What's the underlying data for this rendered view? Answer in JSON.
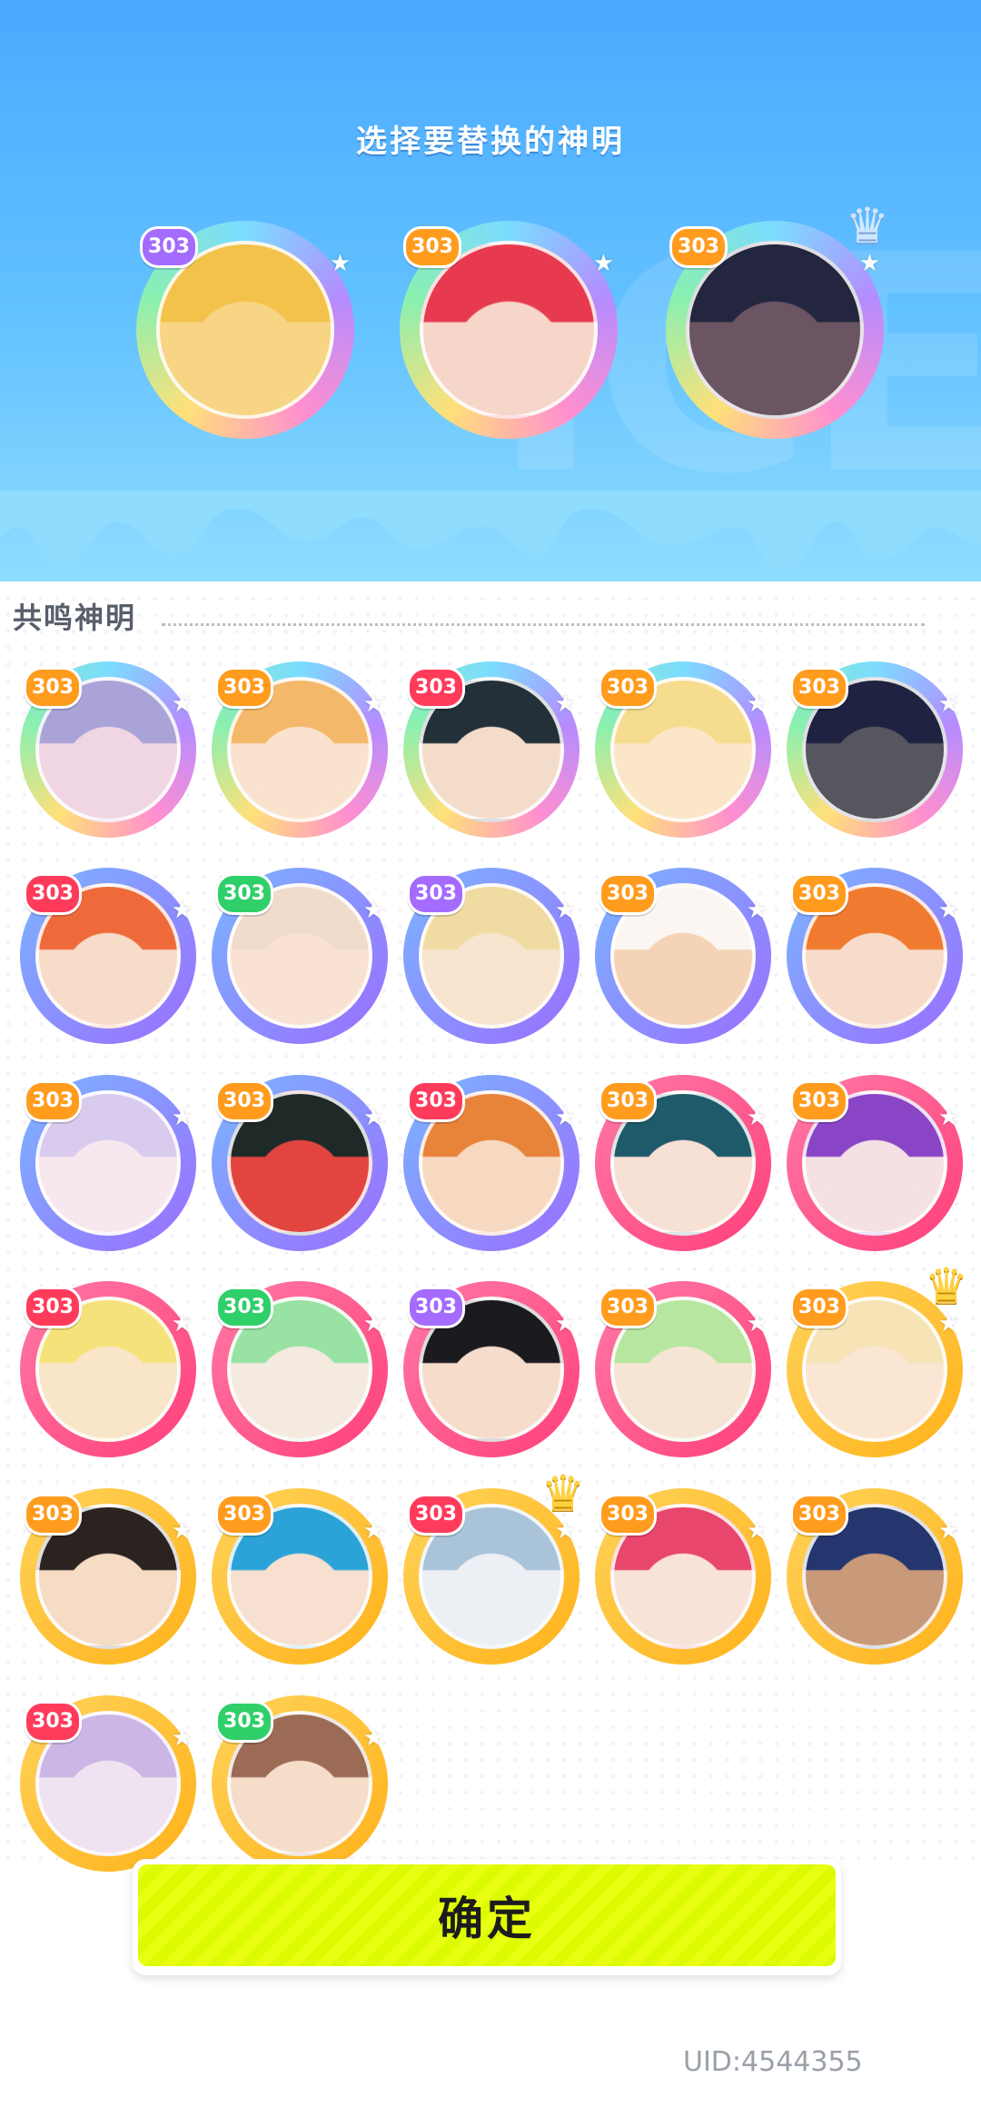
{
  "header": {
    "title": "选择要替换的神明"
  },
  "selected_gods": [
    {
      "level": "303",
      "rarity": "rainbow",
      "face": "#f7d584",
      "hair": "#f3c24a",
      "crown": null
    },
    {
      "level": "303",
      "rarity": "rainbow",
      "face": "#f6d6c9",
      "hair": "#e83a4e",
      "crown": null
    },
    {
      "level": "303",
      "rarity": "rainbow",
      "face": "#6b5563",
      "hair": "#24263f",
      "crown": "ice"
    }
  ],
  "section": {
    "title": "共鸣神明"
  },
  "gods": [
    {
      "level": "303",
      "rarity": "rainbow",
      "face": "#f0d6e2",
      "hair": "#a9a3d8",
      "crown": null
    },
    {
      "level": "303",
      "rarity": "rainbow",
      "face": "#f9e3cf",
      "hair": "#f4b86a",
      "crown": null
    },
    {
      "level": "303",
      "rarity": "rainbow",
      "face": "#f4dccb",
      "hair": "#23303a",
      "crown": null
    },
    {
      "level": "303",
      "rarity": "rainbow",
      "face": "#fbe6c8",
      "hair": "#f5dc8e",
      "crown": null
    },
    {
      "level": "303",
      "rarity": "rainbow",
      "face": "#57555e",
      "hair": "#1f2240",
      "crown": null
    },
    {
      "level": "303",
      "rarity": "purple",
      "face": "#f7dcc9",
      "hair": "#ef6a3b",
      "crown": null
    },
    {
      "level": "303",
      "rarity": "purple",
      "face": "#f9e2d3",
      "hair": "#f0dccc",
      "crown": null
    },
    {
      "level": "303",
      "rarity": "purple",
      "face": "#f7e5cf",
      "hair": "#f0dba3",
      "crown": null
    },
    {
      "level": "303",
      "rarity": "purple",
      "face": "#f5d3b7",
      "hair": "#fbf6f2",
      "crown": null
    },
    {
      "level": "303",
      "rarity": "purple",
      "face": "#f8dccb",
      "hair": "#f07a30",
      "crown": null
    },
    {
      "level": "303",
      "rarity": "purple",
      "face": "#f7e7ef",
      "hair": "#d8cbee",
      "crown": null
    },
    {
      "level": "303",
      "rarity": "purple",
      "face": "#e2453f",
      "hair": "#1f2a28",
      "crown": null
    },
    {
      "level": "303",
      "rarity": "purple",
      "face": "#f7d9c2",
      "hair": "#e8833a",
      "crown": null
    },
    {
      "level": "303",
      "rarity": "pink",
      "face": "#f7e0d4",
      "hair": "#1f5a6b",
      "crown": null
    },
    {
      "level": "303",
      "rarity": "pink",
      "face": "#f5e1e4",
      "hair": "#8a45c6",
      "crown": null
    },
    {
      "level": "303",
      "rarity": "pink",
      "face": "#f9e5c7",
      "hair": "#f6e27a",
      "crown": null
    },
    {
      "level": "303",
      "rarity": "pink",
      "face": "#f5eae0",
      "hair": "#98e2a3",
      "crown": null
    },
    {
      "level": "303",
      "rarity": "pink",
      "face": "#f5dccb",
      "hair": "#1a1a1f",
      "crown": null
    },
    {
      "level": "303",
      "rarity": "pink",
      "face": "#f6e5d4",
      "hair": "#b7e6a0",
      "crown": null
    },
    {
      "level": "303",
      "rarity": "gold",
      "face": "#fbe6d4",
      "hair": "#f6e3b6",
      "crown": "gold"
    },
    {
      "level": "303",
      "rarity": "gold",
      "face": "#f6dcc5",
      "hair": "#2a2320",
      "crown": null
    },
    {
      "level": "303",
      "rarity": "gold",
      "face": "#f7e0cf",
      "hair": "#2ba3d9",
      "crown": null
    },
    {
      "level": "303",
      "rarity": "gold",
      "face": "#eceff4",
      "hair": "#a9c3d9",
      "crown": "gold"
    },
    {
      "level": "303",
      "rarity": "gold",
      "face": "#f7e3d8",
      "hair": "#e8466c",
      "crown": null
    },
    {
      "level": "303",
      "rarity": "gold",
      "face": "#c99a7a",
      "hair": "#25366e",
      "crown": null
    },
    {
      "level": "303",
      "rarity": "gold",
      "face": "#efe3f2",
      "hair": "#cbb6e6",
      "crown": null
    },
    {
      "level": "303",
      "rarity": "gold",
      "face": "#f5ddca",
      "hair": "#9c6b55",
      "crown": null
    }
  ],
  "confirm": {
    "label": "确定"
  },
  "footer": {
    "uid": "UID:4544355"
  },
  "colors": {
    "rainbow_ring": "#b58cff",
    "purple_ring": "#9b6dff",
    "pink_ring": "#ff3f7a",
    "gold_ring": "#ffb21a",
    "badge_purple": "#a46bff",
    "badge_orange": "#ff9c1e",
    "badge_red": "#ff3b5c",
    "badge_green": "#2fcf6a",
    "button": "#e3ff00"
  }
}
